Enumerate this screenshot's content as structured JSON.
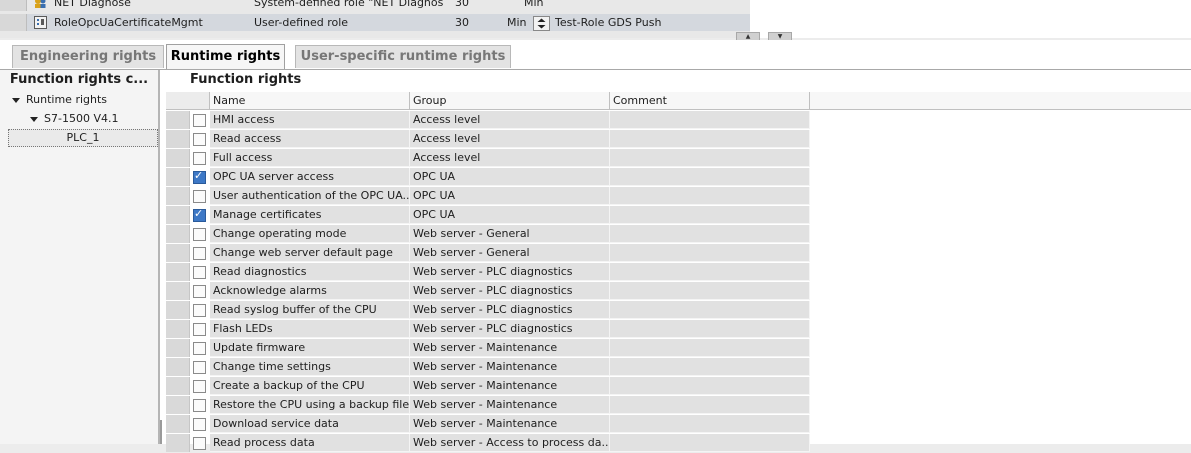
{
  "roles_table": {
    "rows": [
      {
        "name": "NET Diagnose",
        "type": "System-defined role \"NET Diagnos...",
        "duration": "30",
        "unit": "Min",
        "description": ""
      },
      {
        "name": "RoleOpcUaCertificateMgmt",
        "type": "User-defined role",
        "duration": "30",
        "unit": "Min",
        "description": "Test-Role GDS Push"
      }
    ]
  },
  "tabs": [
    {
      "label": "Engineering rights",
      "active": false
    },
    {
      "label": "Runtime rights",
      "active": true
    },
    {
      "label": "User-specific runtime rights",
      "active": false
    }
  ],
  "tree": {
    "title": "Function rights c...",
    "items": [
      {
        "label": "Runtime rights"
      },
      {
        "label": "S7-1500 V4.1"
      },
      {
        "label": "PLC_1"
      }
    ]
  },
  "function_rights": {
    "title": "Function rights",
    "columns": {
      "name": "Name",
      "group": "Group",
      "comment": "Comment"
    },
    "rows": [
      {
        "name": "HMI access",
        "group": "Access level",
        "checked": false
      },
      {
        "name": "Read access",
        "group": "Access level",
        "checked": false
      },
      {
        "name": "Full access",
        "group": "Access level",
        "checked": false
      },
      {
        "name": "OPC UA server access",
        "group": "OPC UA",
        "checked": true
      },
      {
        "name": "User authentication of the OPC UA...",
        "group": "OPC UA",
        "checked": false
      },
      {
        "name": "Manage certificates",
        "group": "OPC UA",
        "checked": true
      },
      {
        "name": "Change operating mode",
        "group": "Web server - General",
        "checked": false
      },
      {
        "name": "Change web server default page",
        "group": "Web server - General",
        "checked": false
      },
      {
        "name": "Read diagnostics",
        "group": "Web server - PLC diagnostics",
        "checked": false
      },
      {
        "name": "Acknowledge alarms",
        "group": "Web server - PLC diagnostics",
        "checked": false
      },
      {
        "name": "Read syslog buffer of the CPU",
        "group": "Web server - PLC diagnostics",
        "checked": false
      },
      {
        "name": "Flash LEDs",
        "group": "Web server - PLC diagnostics",
        "checked": false
      },
      {
        "name": "Update firmware",
        "group": "Web server - Maintenance",
        "checked": false
      },
      {
        "name": "Change time settings",
        "group": "Web server - Maintenance",
        "checked": false
      },
      {
        "name": "Create a backup of the CPU",
        "group": "Web server - Maintenance",
        "checked": false
      },
      {
        "name": "Restore the CPU using a backup file",
        "group": "Web server - Maintenance",
        "checked": false
      },
      {
        "name": "Download service data",
        "group": "Web server - Maintenance",
        "checked": false
      },
      {
        "name": "Read process data",
        "group": "Web server - Access to process da...",
        "checked": false
      }
    ]
  }
}
